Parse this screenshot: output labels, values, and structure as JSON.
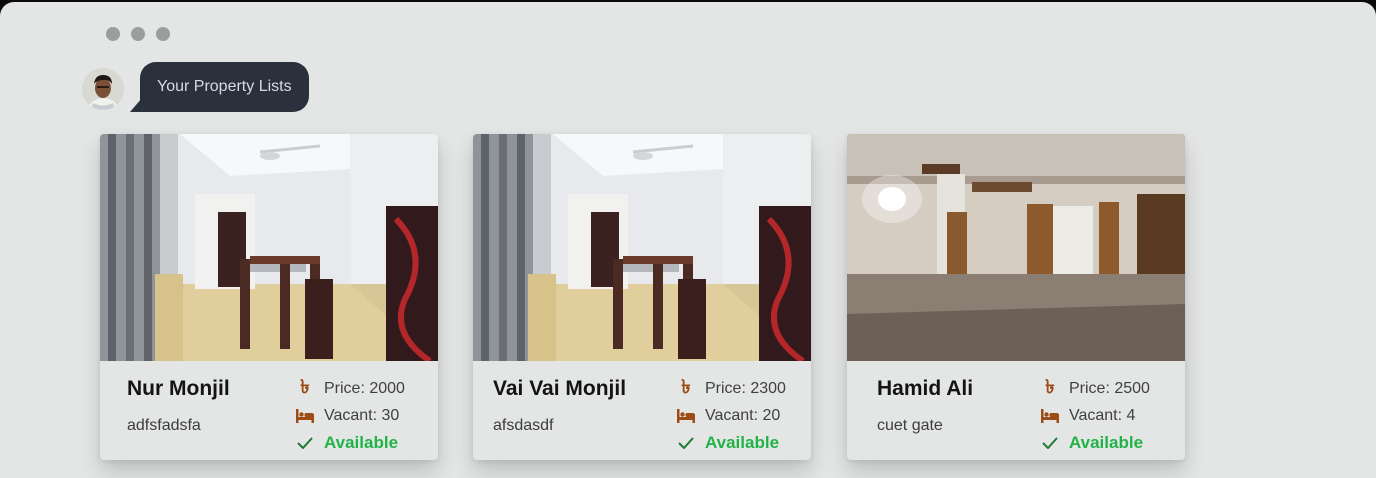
{
  "header": {
    "bubble_text": "Your Property Lists"
  },
  "colors": {
    "accent_brown": "#9b4d15",
    "available_green": "#22b348",
    "bubble_bg": "#2a303c"
  },
  "icons": {
    "price": "taka-icon",
    "vacant": "bed-icon",
    "status": "check-icon"
  },
  "properties": [
    {
      "name": "Nur Monjil",
      "address": "adfsfadsfa",
      "price": "Price: 2000",
      "vacant": "Vacant: 30",
      "status": "Available"
    },
    {
      "name": "Vai Vai Monjil",
      "address": "afsdasdf",
      "price": "Price: 2300",
      "vacant": "Vacant: 20",
      "status": "Available"
    },
    {
      "name": "Hamid Ali",
      "address": "cuet gate",
      "price": "Price: 2500",
      "vacant": "Vacant: 4",
      "status": "Available"
    }
  ],
  "price_symbol": "৳"
}
